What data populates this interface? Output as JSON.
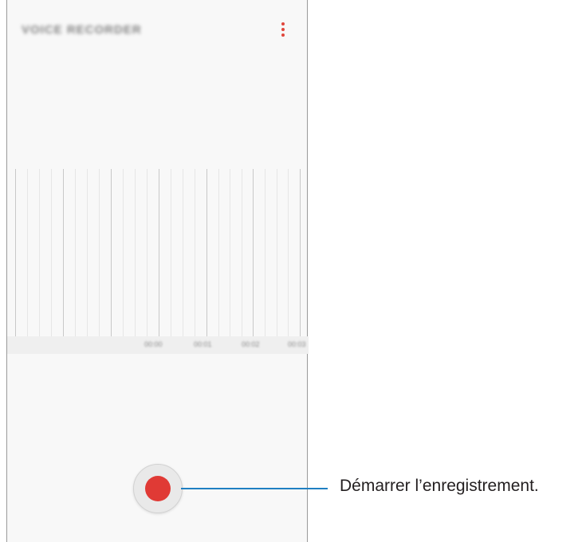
{
  "app_bar": {
    "title": "VOICE RECORDER",
    "more_icon": "more-vertical-icon",
    "accent_color": "#e0473c"
  },
  "timeline": {
    "labels": [
      "00:00",
      "00:01",
      "00:02",
      "00:03"
    ]
  },
  "record": {
    "icon": "record-icon",
    "color": "#e03a35"
  },
  "callout": {
    "text": "Démarrer l’enregistrement.",
    "line_color": "#1f7fc2"
  }
}
